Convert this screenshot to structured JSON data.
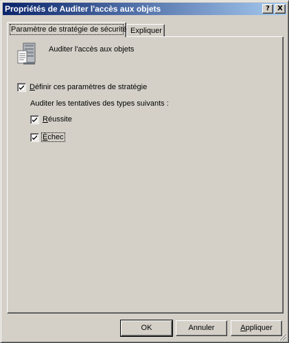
{
  "window": {
    "title": "Propriétés de Auditer l'accès aux objets",
    "help_label": "?",
    "close_label": "X"
  },
  "tabs": [
    {
      "label": "Paramètre de stratégie de sécurité",
      "selected": true
    },
    {
      "label": "Expliquer",
      "selected": false
    }
  ],
  "policy": {
    "icon": "server-policy-icon",
    "name": "Auditer l'accès aux objets"
  },
  "define_checkbox": {
    "mnemonic": "D",
    "rest": "éfinir ces paramètres de stratégie",
    "checked": true
  },
  "audit_types_label": "Auditer les tentatives des types suivants :",
  "success_checkbox": {
    "mnemonic": "R",
    "rest": "éussite",
    "checked": true
  },
  "failure_checkbox": {
    "mnemonic": "É",
    "rest": "chec",
    "checked": true
  },
  "buttons": {
    "ok": "OK",
    "cancel": "Annuler",
    "apply_mnemonic": "A",
    "apply_rest": "ppliquer"
  },
  "colors": {
    "face": "#d4d0c8",
    "title_start": "#0a246a",
    "title_end": "#a6caf0"
  }
}
